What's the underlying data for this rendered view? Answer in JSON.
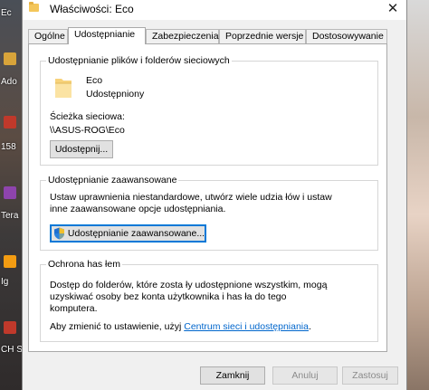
{
  "desktop": {
    "left_labels": [
      "Ec",
      "Ado",
      "158",
      "Tera",
      "Ig",
      "CH S"
    ]
  },
  "window": {
    "title": "Właściwości: Eco",
    "close_glyph": "✕"
  },
  "tabs": [
    {
      "label": "Ogólne"
    },
    {
      "label": "Udostępnianie"
    },
    {
      "label": "Zabezpieczenia"
    },
    {
      "label": "Poprzednie wersje"
    },
    {
      "label": "Dostosowywanie"
    }
  ],
  "sharing_group": {
    "title": "Udostępnianie plików i folderów sieciowych",
    "folder_name": "Eco",
    "folder_status": "Udostępniony",
    "path_label": "Ścieżka sieciowa:",
    "path_value": "\\\\ASUS-ROG\\Eco",
    "share_button": "Udostępnij..."
  },
  "advanced_group": {
    "title": "Udostępnianie zaawansowane",
    "description_line1": "Ustaw uprawnienia niestandardowe, utwórz wiele udzia łów i ustaw",
    "description_line2": "inne zaawansowane opcje udostępniania.",
    "button": "Udostępnianie zaawansowane..."
  },
  "password_group": {
    "title": "Ochrona has łem",
    "line1": "Dostęp do folderów, które zosta ły udostępnione wszystkim, mogą",
    "line2": "uzyskiwać osoby bez konta użytkownika i has ła do tego",
    "line3": "komputera.",
    "change_prefix": "Aby zmienić to ustawienie, użyj ",
    "change_link": "Centrum sieci i udostępniania",
    "change_suffix": "."
  },
  "footer": {
    "close_button": "Zamknij",
    "cancel_button": "Anuluj",
    "apply_button": "Zastosuj"
  },
  "colors": {
    "link": "#0066cc",
    "focus_border": "#0078d7"
  }
}
